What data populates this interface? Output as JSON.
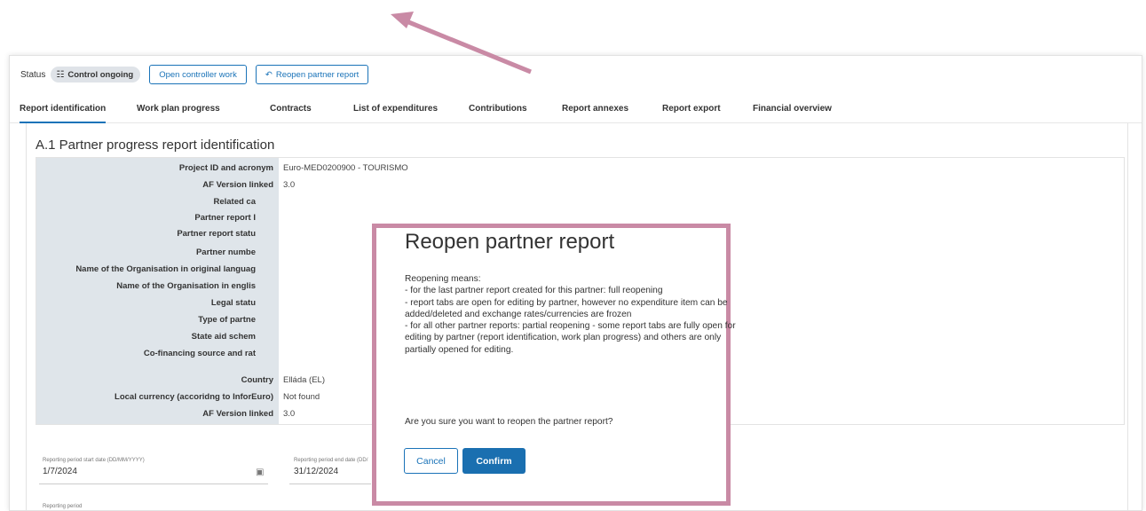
{
  "status": {
    "label": "Status",
    "badge": "Control ongoing",
    "open_controller_work": "Open controller work",
    "reopen_partner_report": "Reopen partner report"
  },
  "tabs": [
    {
      "label": "Report identification",
      "active": true
    },
    {
      "label": "Work plan progress"
    },
    {
      "label": "Contracts"
    },
    {
      "label": "List of expenditures"
    },
    {
      "label": "Contributions"
    },
    {
      "label": "Report annexes"
    },
    {
      "label": "Report export"
    },
    {
      "label": "Financial overview"
    }
  ],
  "section": {
    "title": "A.1 Partner progress report identification",
    "rows": [
      {
        "label": "Project ID and acronym",
        "value": "Euro-MED0200900 - TOURISMO"
      },
      {
        "label": "AF Version linked",
        "value": "3.0"
      },
      {
        "label": "Related ca",
        "value": ""
      },
      {
        "label": "Partner report I",
        "value": ""
      },
      {
        "label": "Partner report statu",
        "value": ""
      },
      {
        "label": "Partner numbe",
        "value": ""
      },
      {
        "label": "Name of the Organisation in original languag",
        "value": ""
      },
      {
        "label": "Name of the Organisation in englis",
        "value": ""
      },
      {
        "label": "Legal statu",
        "value": ""
      },
      {
        "label": "Type of partne",
        "value": ""
      },
      {
        "label": "State aid schem",
        "value": ""
      },
      {
        "label": "Co-financing source and rat",
        "value": ""
      },
      {
        "label": "Country",
        "value": "Elláda (EL)"
      },
      {
        "label": "Local currency (accoridng to InforEuro)",
        "value": "Not found"
      },
      {
        "label": "AF Version linked",
        "value": "3.0"
      }
    ]
  },
  "dates": {
    "start_label": "Reporting period start date (DD/MM/YYYY)",
    "start_value": "1/7/2024",
    "end_label": "Reporting period end date (DD/",
    "end_value": "31/12/2024",
    "period_label": "Reporting period"
  },
  "dialog": {
    "title": "Reopen partner report",
    "lines": [
      "Reopening means:",
      "- for the last partner report created for this partner: full reopening",
      "- report tabs are open for editing by partner, however no expenditure item can be added/deleted and exchange rates/currencies are frozen",
      "- for all other partner reports: partial reopening - some report tabs are fully open for editing by partner (report identification, work plan progress) and others are only partially opened for editing."
    ],
    "question": "Are you sure you want to reopen the partner report?",
    "cancel": "Cancel",
    "confirm": "Confirm"
  },
  "colors": {
    "accent": "#1a73b8",
    "highlight": "#c98aa5"
  }
}
